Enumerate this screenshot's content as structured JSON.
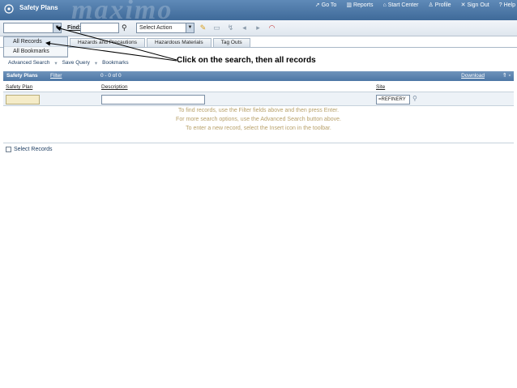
{
  "app": {
    "title": "Safety Plans",
    "brand": "maximo"
  },
  "topnav": [
    {
      "label": "Go To",
      "icon": "goto-icon"
    },
    {
      "label": "Reports",
      "icon": "reports-icon"
    },
    {
      "label": "Start Center",
      "icon": "start-center-icon"
    },
    {
      "label": "Profile",
      "icon": "profile-icon"
    },
    {
      "label": "Sign Out",
      "icon": "sign-out-icon"
    },
    {
      "label": "Help",
      "icon": "help-icon"
    }
  ],
  "toolbar": {
    "find_label": "Find:",
    "action_select": "Select Action"
  },
  "query_menu": [
    {
      "label": "All Records"
    },
    {
      "label": "All Bookmarks"
    }
  ],
  "tabs": [
    {
      "label": "Hazards and Precautions"
    },
    {
      "label": "Hazardous Materials"
    },
    {
      "label": "Tag Outs"
    }
  ],
  "callout": "Click on the search, then all records",
  "subbar": {
    "advanced_search": "Advanced Search",
    "save_query": "Save Query",
    "bookmarks": "Bookmarks"
  },
  "section": {
    "name": "Safety Plans",
    "filter": "Filter",
    "pager": "0 - 0 of 0",
    "download": "Download"
  },
  "columns": {
    "safety_plan": "Safety Plan",
    "description": "Description",
    "site": "Site"
  },
  "filters": {
    "site_value": "=REFINERY"
  },
  "messages": [
    "To find records, use the Filter fields above and then press Enter.",
    "For more search options, use the Advanced Search button above.",
    "To enter a new record, select the Insert icon in the toolbar."
  ],
  "select_records": "Select Records",
  "colors": {
    "header": "#4d77a5",
    "accent_text": "#b8a16a"
  }
}
